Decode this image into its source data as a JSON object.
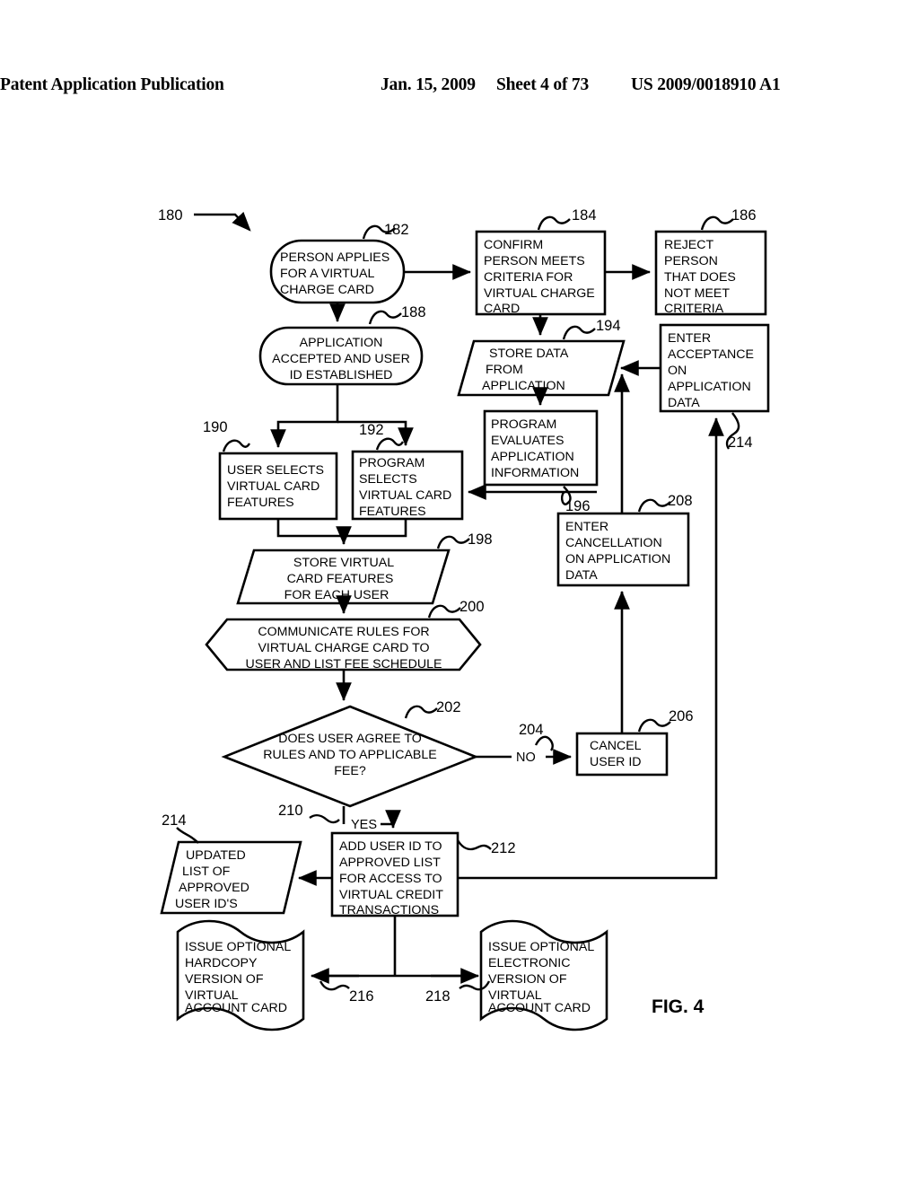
{
  "header": {
    "publication": "Patent Application Publication",
    "date": "Jan. 15, 2009",
    "sheet": "Sheet 4 of 73",
    "doc_number": "US 2009/0018910 A1"
  },
  "figure": {
    "caption": "FIG. 4",
    "diagram_ref": "180"
  },
  "nodes": [
    {
      "ref": "182",
      "shape": "rounded",
      "lines": [
        "PERSON APPLIES",
        "FOR A VIRTUAL",
        "CHARGE CARD"
      ]
    },
    {
      "ref": "184",
      "shape": "rect",
      "lines": [
        "CONFIRM",
        "PERSON MEETS",
        "CRITERIA FOR",
        "VIRTUAL CHARGE",
        "CARD"
      ]
    },
    {
      "ref": "186",
      "shape": "rect",
      "lines": [
        "REJECT",
        "PERSON",
        "THAT DOES",
        "NOT MEET",
        "CRITERIA"
      ]
    },
    {
      "ref": "188",
      "shape": "rounded",
      "lines": [
        "APPLICATION",
        "ACCEPTED AND USER",
        "ID ESTABLISHED"
      ]
    },
    {
      "ref": "194",
      "shape": "parallelogram",
      "lines": [
        "STORE DATA",
        "FROM",
        "APPLICATION"
      ]
    },
    {
      "ref": "214",
      "shape": "rect",
      "lines": [
        "ENTER",
        "ACCEPTANCE",
        "ON",
        "APPLICATION",
        "DATA"
      ]
    },
    {
      "ref": "196",
      "shape": "rect",
      "lines": [
        "PROGRAM",
        "EVALUATES",
        "APPLICATION",
        "INFORMATION"
      ]
    },
    {
      "ref": "190",
      "shape": "rect",
      "lines": [
        "USER SELECTS",
        "VIRTUAL CARD",
        "FEATURES"
      ]
    },
    {
      "ref": "192",
      "shape": "rect",
      "lines": [
        "PROGRAM",
        "SELECTS",
        "VIRTUAL CARD",
        "FEATURES"
      ]
    },
    {
      "ref": "208",
      "shape": "rect",
      "lines": [
        "ENTER",
        "CANCELLATION",
        "ON APPLICATION",
        "DATA"
      ]
    },
    {
      "ref": "198",
      "shape": "parallelogram",
      "lines": [
        "STORE VIRTUAL",
        "CARD FEATURES",
        "FOR EACH USER"
      ]
    },
    {
      "ref": "200",
      "shape": "hexagon",
      "lines": [
        "COMMUNICATE RULES FOR",
        "VIRTUAL CHARGE CARD TO",
        "USER AND LIST FEE SCHEDULE"
      ]
    },
    {
      "ref": "202",
      "shape": "diamond",
      "lines": [
        "DOES USER AGREE TO",
        "RULES AND TO APPLICABLE",
        "FEE?"
      ]
    },
    {
      "ref": "206",
      "shape": "rect",
      "lines": [
        "CANCEL",
        "USER ID"
      ]
    },
    {
      "ref": "214b",
      "shape": "parallelogram",
      "lines": [
        "UPDATED",
        "LIST OF",
        "APPROVED",
        "USER ID'S"
      ]
    },
    {
      "ref": "212",
      "shape": "rect",
      "lines": [
        "ADD USER ID TO",
        "APPROVED LIST",
        "FOR ACCESS TO",
        "VIRTUAL CREDIT",
        "TRANSACTIONS"
      ]
    },
    {
      "ref": "216",
      "shape": "document",
      "lines": [
        "ISSUE OPTIONAL",
        "HARDCOPY",
        "VERSION OF",
        "VIRTUAL",
        "ACCOUNT CARD"
      ]
    },
    {
      "ref": "218",
      "shape": "document",
      "lines": [
        "ISSUE OPTIONAL",
        "ELECTRONIC",
        "VERSION OF",
        "VIRTUAL",
        "ACCOUNT CARD"
      ]
    }
  ],
  "edge_labels": {
    "no": "NO",
    "yes": "YES",
    "no_ref": "204",
    "yes_ref": "210"
  },
  "ref_labels": {
    "r180": "180",
    "r182": "182",
    "r184": "184",
    "r186": "186",
    "r188": "188",
    "r190": "190",
    "r192": "192",
    "r194": "194",
    "r196": "196",
    "r198": "198",
    "r200": "200",
    "r202": "202",
    "r204": "204",
    "r206": "206",
    "r208": "208",
    "r210": "210",
    "r212": "212",
    "r214_right": "214",
    "r214_left": "214",
    "r216": "216",
    "r218": "218"
  }
}
